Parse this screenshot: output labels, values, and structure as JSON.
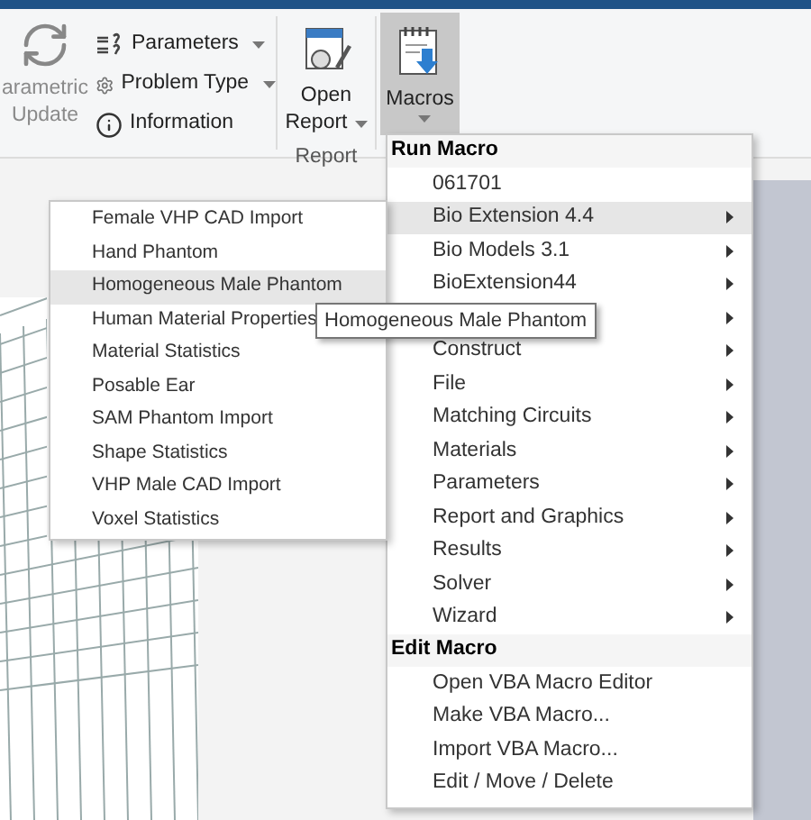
{
  "ribbon": {
    "parametric_update": {
      "label": "arametric Update",
      "disabled": true
    },
    "small_buttons": [
      {
        "label": "Parameters",
        "dropdown": true
      },
      {
        "label": "Problem Type",
        "dropdown": true
      },
      {
        "label": "Information",
        "dropdown": false
      }
    ],
    "open_report": {
      "label": "Open Report",
      "dropdown": true
    },
    "report_group": {
      "label": "Report"
    },
    "macros": {
      "label": "Macros",
      "pressed": true,
      "dropdown": true
    }
  },
  "macro_menu": {
    "sections": [
      {
        "header": "Run Macro",
        "items": [
          {
            "label": "061701",
            "submenu": false,
            "selected": false
          },
          {
            "label": "Bio Extension 4.4",
            "submenu": true,
            "selected": true
          },
          {
            "label": "Bio Models 3.1",
            "submenu": true,
            "selected": false
          },
          {
            "label": "BioExtension44",
            "submenu": true,
            "selected": false
          },
          {
            "submenu": true,
            "selected": false
          },
          {
            "label": "Construct",
            "submenu": true,
            "selected": false
          },
          {
            "label": "File",
            "submenu": true,
            "selected": false
          },
          {
            "label": "Matching Circuits",
            "submenu": true,
            "selected": false
          },
          {
            "label": "Materials",
            "submenu": true,
            "selected": false
          },
          {
            "label": "Parameters",
            "submenu": true,
            "selected": false
          },
          {
            "label": "Report and Graphics",
            "submenu": true,
            "selected": false
          },
          {
            "label": "Results",
            "submenu": true,
            "selected": false
          },
          {
            "label": "Solver",
            "submenu": true,
            "selected": false
          },
          {
            "label": "Wizard",
            "submenu": true,
            "selected": false
          }
        ]
      },
      {
        "header": "Edit Macro",
        "items": [
          {
            "label": "Open VBA Macro Editor",
            "submenu": false,
            "selected": false
          },
          {
            "label": "Make VBA Macro...",
            "submenu": false,
            "selected": false
          },
          {
            "label": "Import VBA Macro...",
            "submenu": false,
            "selected": false
          },
          {
            "label": "Edit / Move / Delete",
            "submenu": false,
            "selected": false
          }
        ]
      }
    ]
  },
  "submenu": {
    "items": [
      {
        "label": "Female VHP CAD Import",
        "selected": false
      },
      {
        "label": "Hand Phantom",
        "selected": false
      },
      {
        "label": "Homogeneous Male Phantom",
        "selected": true
      },
      {
        "label": "Human Material Properties",
        "selected": false
      },
      {
        "label": "Material Statistics",
        "selected": false
      },
      {
        "label": "Posable Ear",
        "selected": false
      },
      {
        "label": "SAM Phantom Import",
        "selected": false
      },
      {
        "label": "Shape Statistics",
        "selected": false
      },
      {
        "label": "VHP Male CAD Import",
        "selected": false
      },
      {
        "label": "Voxel Statistics",
        "selected": false
      }
    ]
  },
  "tooltip": {
    "text": "Homogeneous Male Phantom"
  }
}
